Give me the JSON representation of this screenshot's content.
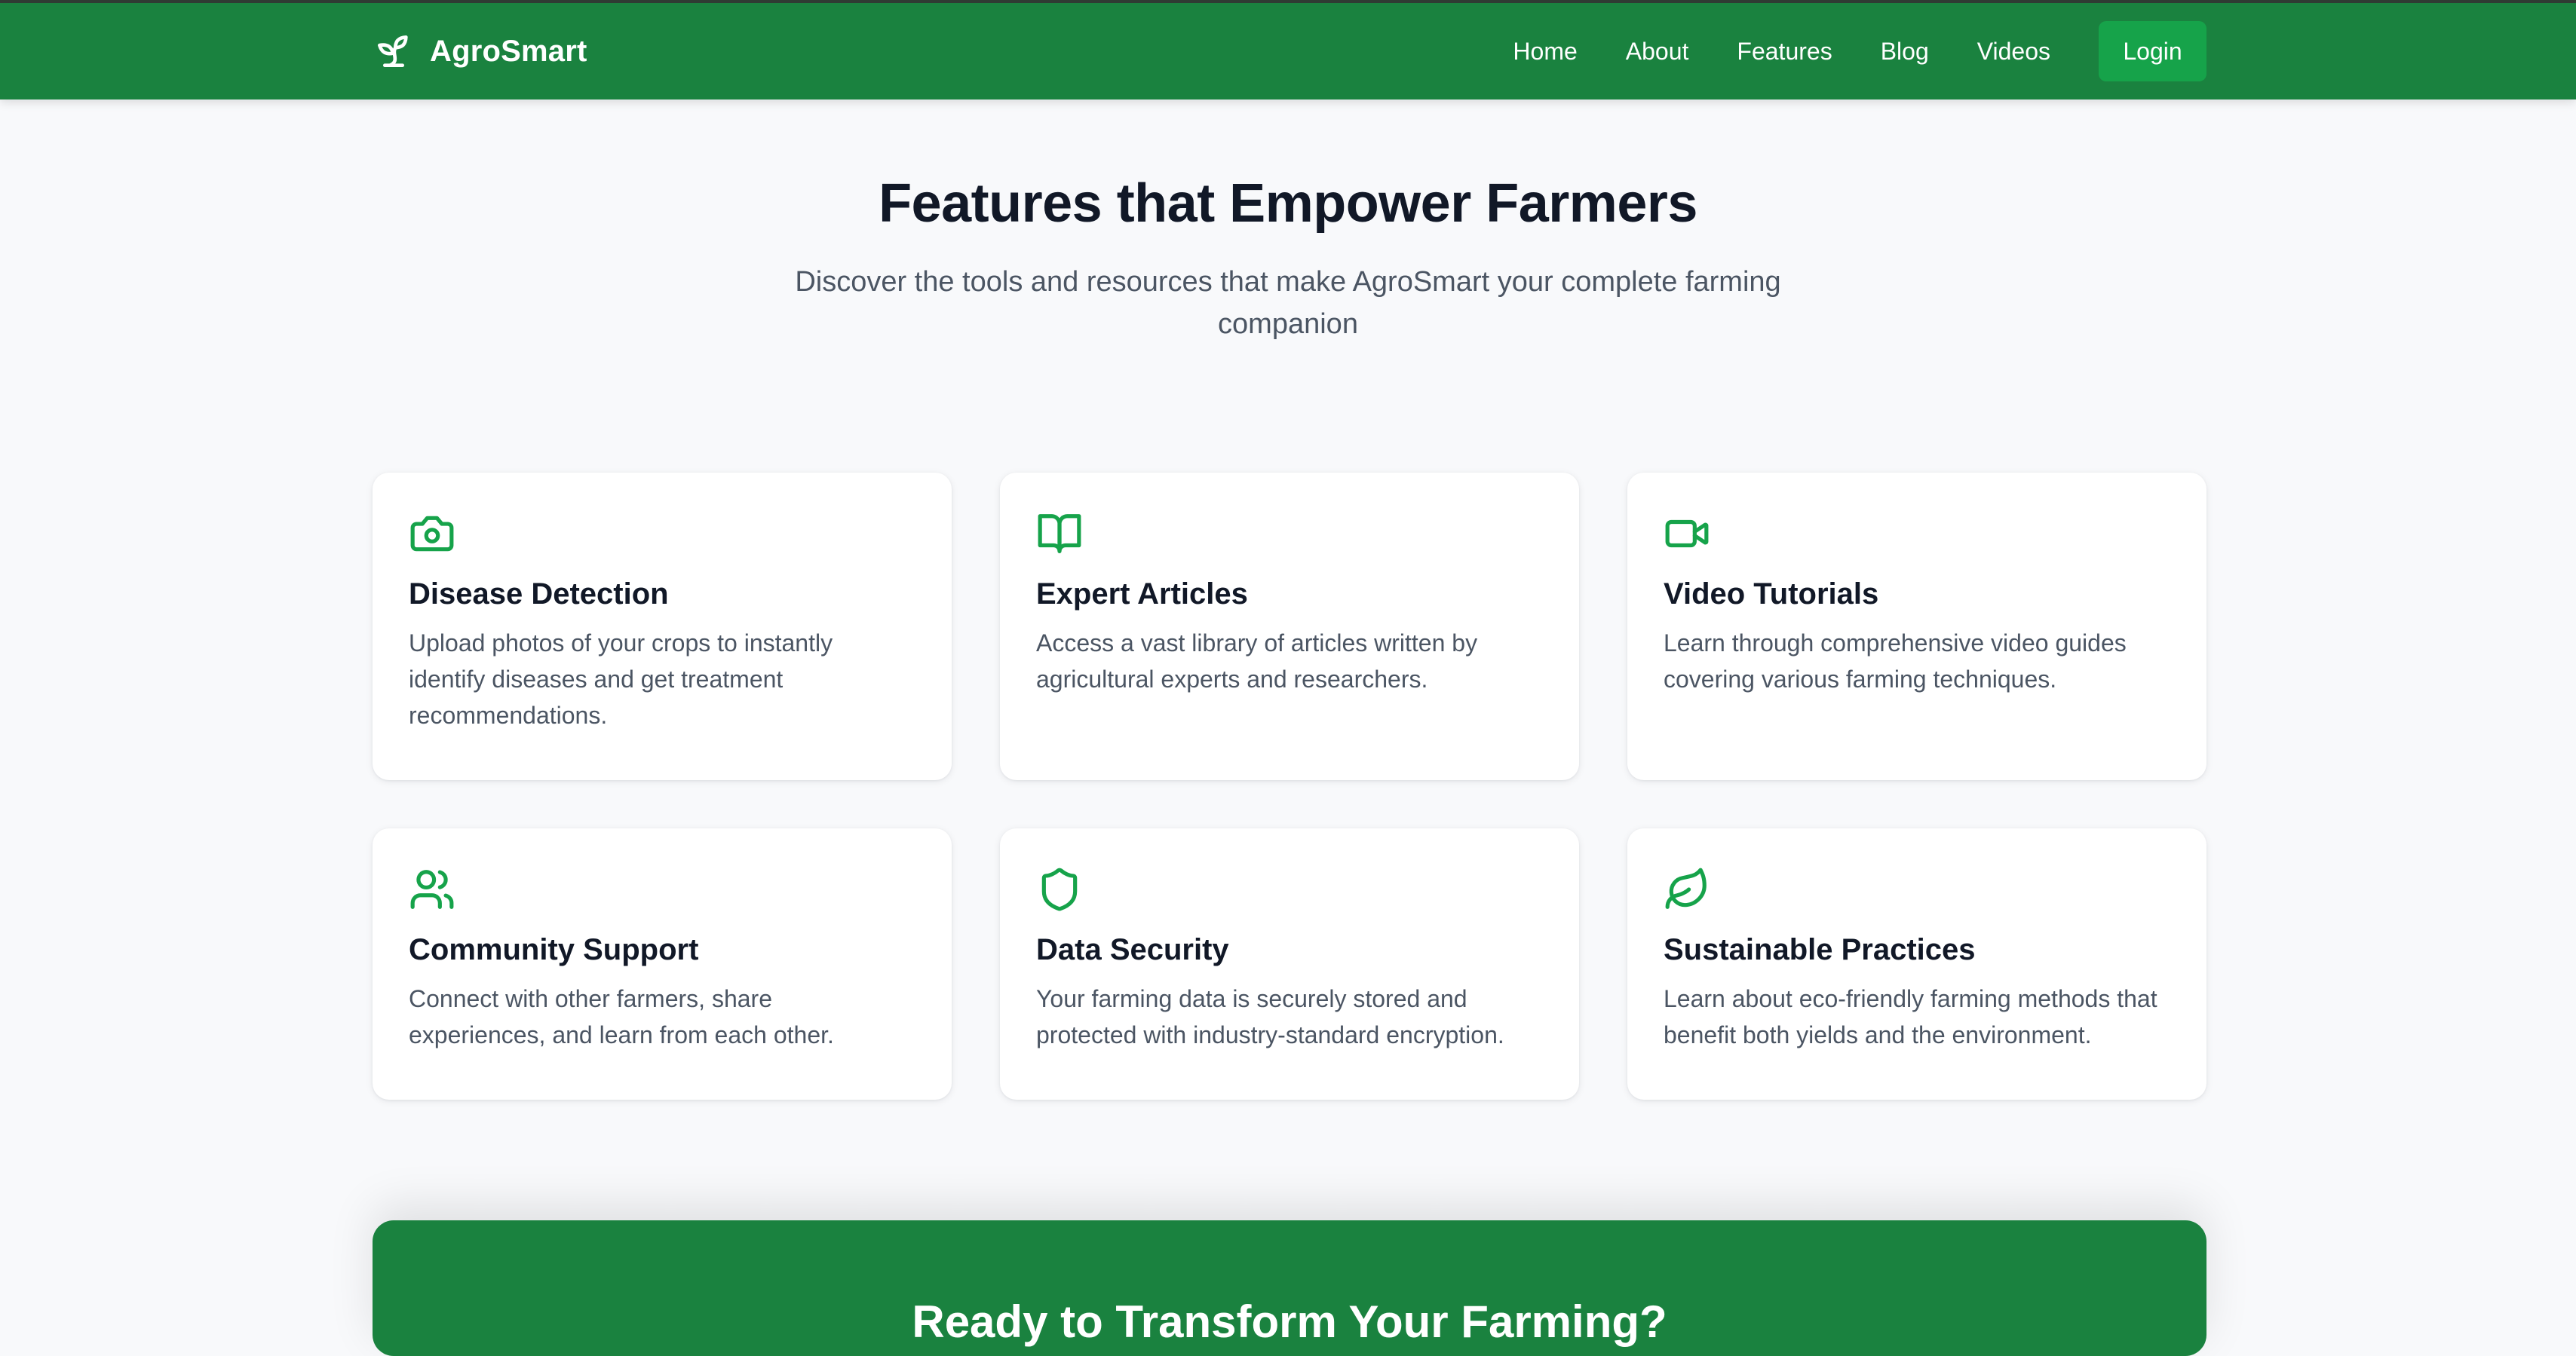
{
  "nav": {
    "brand": "AgroSmart",
    "brand_icon": "sprout-icon",
    "links": [
      "Home",
      "About",
      "Features",
      "Blog",
      "Videos"
    ],
    "login_label": "Login"
  },
  "hero": {
    "title": "Features that Empower Farmers",
    "subtitle": "Discover the tools and resources that make AgroSmart your complete farming companion"
  },
  "features": [
    {
      "icon": "camera-icon",
      "title": "Disease Detection",
      "description": "Upload photos of your crops to instantly identify diseases and get treatment recommendations."
    },
    {
      "icon": "book-open-icon",
      "title": "Expert Articles",
      "description": "Access a vast library of articles written by agricultural experts and researchers."
    },
    {
      "icon": "video-camera-icon",
      "title": "Video Tutorials",
      "description": "Learn through comprehensive video guides covering various farming techniques."
    },
    {
      "icon": "users-icon",
      "title": "Community Support",
      "description": "Connect with other farmers, share experiences, and learn from each other."
    },
    {
      "icon": "shield-icon",
      "title": "Data Security",
      "description": "Your farming data is securely stored and protected with industry-standard encryption."
    },
    {
      "icon": "leaf-icon",
      "title": "Sustainable Practices",
      "description": "Learn about eco-friendly farming methods that benefit both yields and the environment."
    }
  ],
  "cta": {
    "title": "Ready to Transform Your Farming?"
  },
  "colors": {
    "primary": "#1a823f",
    "accent": "#16a34a",
    "background": "#f8f9fb",
    "text": "#111827",
    "muted": "#4b5563"
  }
}
